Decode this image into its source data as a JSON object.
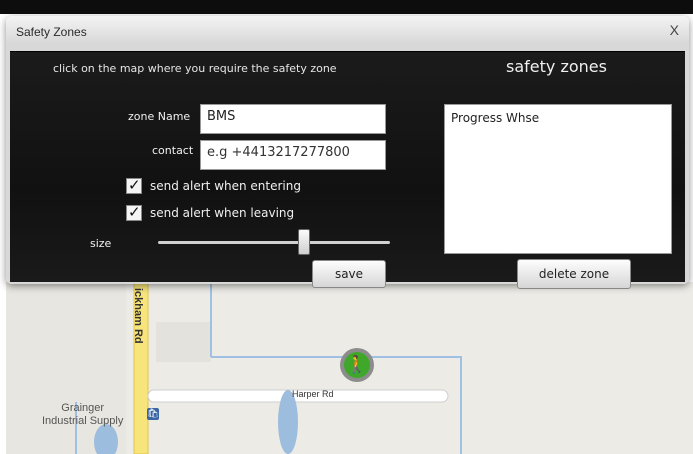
{
  "window": {
    "title": "Safety Zones",
    "close_label": "X"
  },
  "form": {
    "instruction": "click on the map where you require the safety zone",
    "zone_name_label": "zone Name",
    "zone_name_value": "BMS",
    "contact_label": "contact",
    "contact_placeholder": "e.g +4413217277800",
    "alert_entering_label": "send alert when entering",
    "alert_leaving_label": "send alert when leaving",
    "size_label": "size",
    "save_label": "save"
  },
  "zones_panel": {
    "title": "safety zones",
    "items": [
      "Progress Whse"
    ],
    "delete_label": "delete zone"
  },
  "map": {
    "road_vertical": "ickham Rd",
    "road_horizontal": "Harper Rd",
    "business_line1": "Grainger",
    "business_line2": "Industrial Supply"
  },
  "ui_state": {
    "alert_entering_checked": true,
    "alert_leaving_checked": true,
    "size_slider_value": 0.6
  }
}
